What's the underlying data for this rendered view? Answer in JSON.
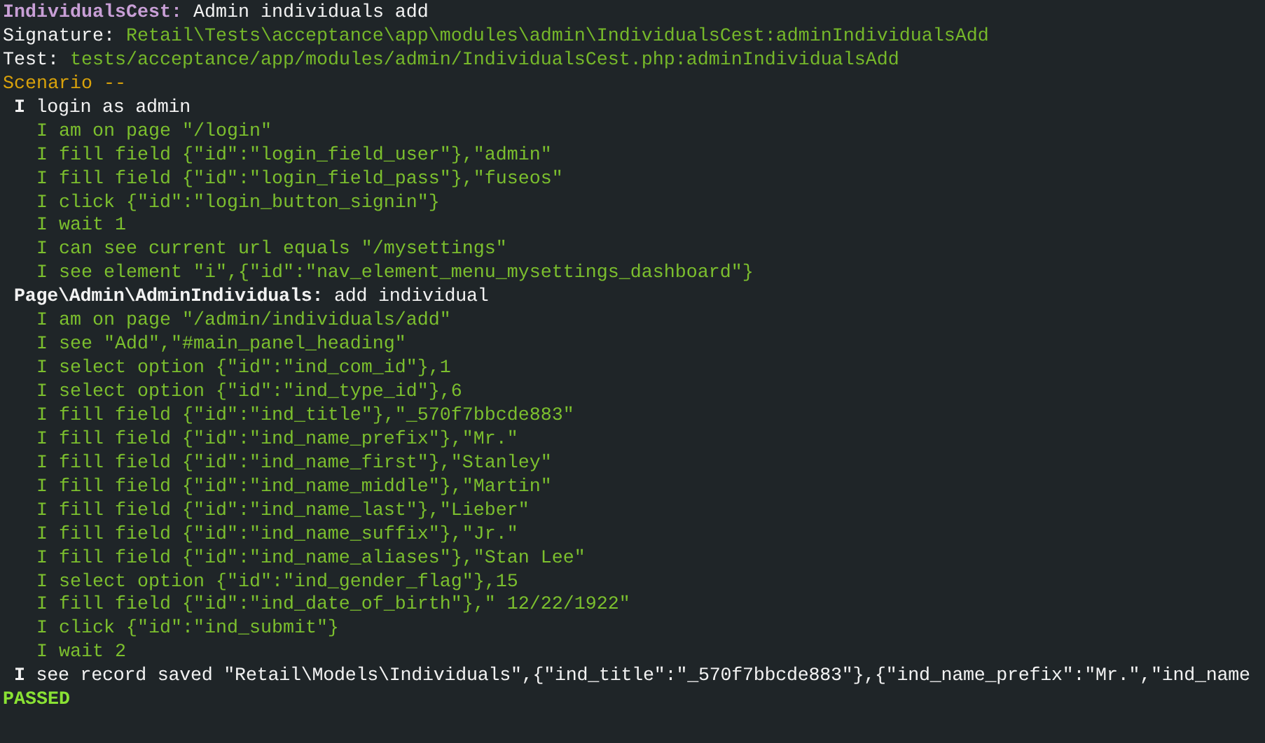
{
  "terminal": {
    "lines": [
      {
        "kind": "title",
        "label": "IndividualsCest:",
        "text": "Admin individuals add"
      },
      {
        "kind": "field",
        "label": "Signature:",
        "text": "Retail\\Tests\\acceptance\\app\\modules\\admin\\IndividualsCest:adminIndividualsAdd"
      },
      {
        "kind": "field",
        "label": "Test:",
        "text": "tests/acceptance/app/modules/admin/IndividualsCest.php:adminIndividualsAdd"
      },
      {
        "kind": "scenario",
        "text": "Scenario --"
      },
      {
        "kind": "step",
        "text": "**I** login as admin"
      },
      {
        "kind": "action",
        "text": "I am on page \"/login\""
      },
      {
        "kind": "action",
        "text": "I fill field {\"id\":\"login_field_user\"},\"admin\""
      },
      {
        "kind": "action",
        "text": "I fill field {\"id\":\"login_field_pass\"},\"fuseos\""
      },
      {
        "kind": "action",
        "text": "I click {\"id\":\"login_button_signin\"}"
      },
      {
        "kind": "action",
        "text": "I wait 1"
      },
      {
        "kind": "action",
        "text": "I can see current url equals \"/mysettings\""
      },
      {
        "kind": "action",
        "text": "I see element \"i\",{\"id\":\"nav_element_menu_mysettings_dashboard\"}"
      },
      {
        "kind": "step",
        "text": "**Page\\Admin\\AdminIndividuals:** add individual"
      },
      {
        "kind": "action",
        "text": "I am on page \"/admin/individuals/add\""
      },
      {
        "kind": "action",
        "text": "I see \"Add\",\"#main_panel_heading\""
      },
      {
        "kind": "action",
        "text": "I select option {\"id\":\"ind_com_id\"},1"
      },
      {
        "kind": "action",
        "text": "I select option {\"id\":\"ind_type_id\"},6"
      },
      {
        "kind": "action",
        "text": "I fill field {\"id\":\"ind_title\"},\"_570f7bbcde883\""
      },
      {
        "kind": "action",
        "text": "I fill field {\"id\":\"ind_name_prefix\"},\"Mr.\""
      },
      {
        "kind": "action",
        "text": "I fill field {\"id\":\"ind_name_first\"},\"Stanley\""
      },
      {
        "kind": "action",
        "text": "I fill field {\"id\":\"ind_name_middle\"},\"Martin\""
      },
      {
        "kind": "action",
        "text": "I fill field {\"id\":\"ind_name_last\"},\"Lieber\""
      },
      {
        "kind": "action",
        "text": "I fill field {\"id\":\"ind_name_suffix\"},\"Jr.\""
      },
      {
        "kind": "action",
        "text": "I fill field {\"id\":\"ind_name_aliases\"},\"Stan Lee\""
      },
      {
        "kind": "action",
        "text": "I select option {\"id\":\"ind_gender_flag\"},15"
      },
      {
        "kind": "action",
        "text": "I fill field {\"id\":\"ind_date_of_birth\"},\" 12/22/1922\""
      },
      {
        "kind": "action",
        "text": "I click {\"id\":\"ind_submit\"}"
      },
      {
        "kind": "action",
        "text": "I wait 2"
      },
      {
        "kind": "step",
        "text": "**I** see record saved \"Retail\\Models\\Individuals\",{\"ind_title\":\"_570f7bbcde883\"},{\"ind_name_prefix\":\"Mr.\",\"ind_name"
      },
      {
        "kind": "passed",
        "text": "PASSED"
      }
    ]
  }
}
